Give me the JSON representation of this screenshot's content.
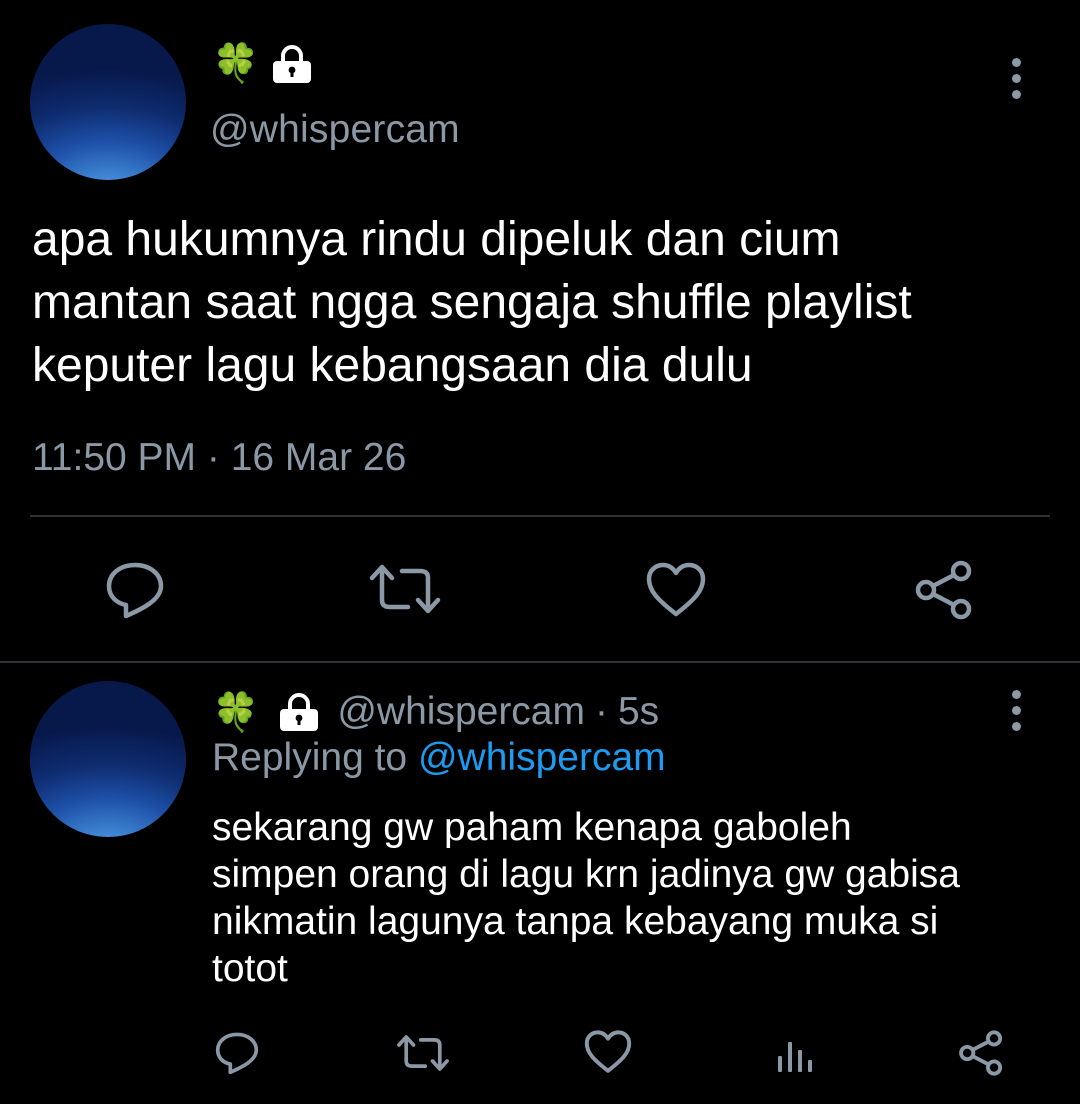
{
  "main_tweet": {
    "name_emoji": "🍀",
    "handle": "@whispercam",
    "text": "apa hukumnya rindu dipeluk dan cium\nmantan saat ngga sengaja shuffle playlist\nkeputer lagu kebangsaan dia dulu",
    "timestamp": "11:50 PM · 16 Mar 26",
    "actions": [
      "reply-icon",
      "retweet-icon",
      "like-icon",
      "share-icon"
    ]
  },
  "reply_tweet": {
    "name_emoji": "🍀",
    "handle": "@whispercam",
    "separator": "·",
    "time": "5s",
    "replying_prefix": "Replying to",
    "replying_handle": "@whispercam",
    "text": "sekarang gw paham kenapa gaboleh\nsimpen orang di lagu krn jadinya gw gabisa\nnikmatin lagunya tanpa kebayang muka si\ntotot",
    "actions": [
      "reply-icon",
      "retweet-icon",
      "like-icon",
      "analytics-icon",
      "share-icon"
    ]
  },
  "colors": {
    "background": "#000000",
    "text_primary": "#ffffff",
    "text_secondary": "#8b98a5",
    "link": "#1d9bf0",
    "divider": "#2f3336",
    "clover": "#3dbd4f"
  }
}
